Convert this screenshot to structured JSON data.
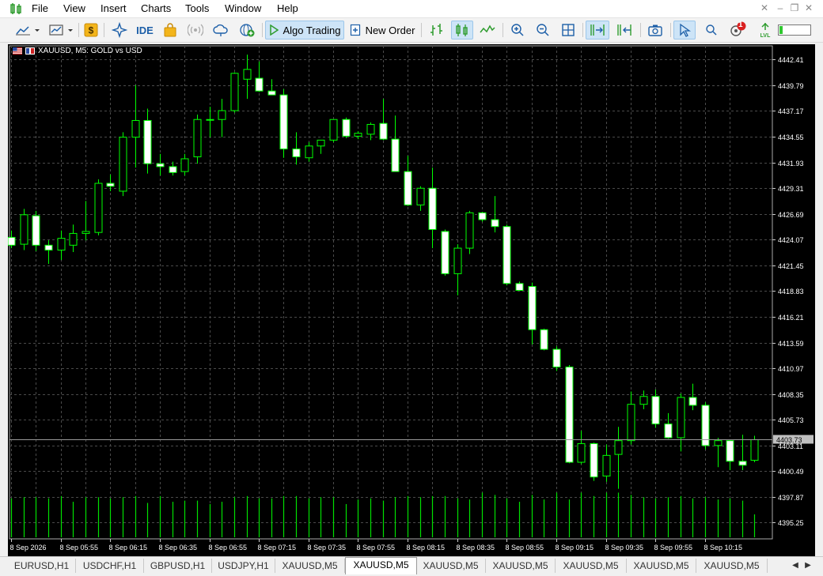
{
  "menu": {
    "items": [
      "File",
      "View",
      "Insert",
      "Charts",
      "Tools",
      "Window",
      "Help"
    ]
  },
  "toolbar": {
    "algo_trading_label": "Algo Trading",
    "new_order_label": "New Order",
    "ide_label": "IDE",
    "notification_count": "1"
  },
  "chart": {
    "title": "XAUUSD, M5:  GOLD vs USD",
    "current_price": "4403.73",
    "colors": {
      "background": "#000000",
      "grid": "#4a4a4a",
      "candle_up": "#000000",
      "candle_down": "#ffffff",
      "candle_border": "#00ff00",
      "volume": "#00e000",
      "price_label": "#c0c0c0",
      "axis_text": "#ffffff"
    }
  },
  "chart_data": {
    "type": "candlestick",
    "symbol": "XAUUSD",
    "timeframe": "M5",
    "y_ticks": [
      "4442.41",
      "4439.79",
      "4437.17",
      "4434.55",
      "4431.93",
      "4429.31",
      "4426.69",
      "4424.07",
      "4421.45",
      "4418.83",
      "4416.21",
      "4413.59",
      "4410.97",
      "4408.35",
      "4405.73",
      "4403.11",
      "4400.49",
      "4397.87",
      "4395.25"
    ],
    "ylim": [
      4393.6,
      4443.8
    ],
    "x_labels": [
      "8 Sep 2026",
      "8 Sep 05:55",
      "8 Sep 06:15",
      "8 Sep 06:35",
      "8 Sep 06:55",
      "8 Sep 07:15",
      "8 Sep 07:35",
      "8 Sep 07:55",
      "8 Sep 08:15",
      "8 Sep 08:35",
      "8 Sep 08:55",
      "8 Sep 09:15",
      "8 Sep 09:35",
      "8 Sep 09:55",
      "8 Sep 10:15"
    ],
    "x_label_every": 4,
    "candles": [
      {
        "o": 4424.3,
        "h": 4425.0,
        "l": 4423.2,
        "c": 4423.5
      },
      {
        "o": 4423.6,
        "h": 4427.2,
        "l": 4423.0,
        "c": 4426.6
      },
      {
        "o": 4426.5,
        "h": 4427.0,
        "l": 4422.9,
        "c": 4423.5
      },
      {
        "o": 4423.5,
        "h": 4424.0,
        "l": 4421.6,
        "c": 4423.0
      },
      {
        "o": 4423.0,
        "h": 4425.0,
        "l": 4422.0,
        "c": 4424.2
      },
      {
        "o": 4423.5,
        "h": 4425.6,
        "l": 4422.8,
        "c": 4424.7
      },
      {
        "o": 4424.7,
        "h": 4428.0,
        "l": 4424.0,
        "c": 4424.9
      },
      {
        "o": 4424.8,
        "h": 4430.2,
        "l": 4424.5,
        "c": 4429.8
      },
      {
        "o": 4429.8,
        "h": 4430.7,
        "l": 4429.0,
        "c": 4429.5
      },
      {
        "o": 4429.0,
        "h": 4435.0,
        "l": 4428.5,
        "c": 4434.5
      },
      {
        "o": 4434.5,
        "h": 4439.8,
        "l": 4431.4,
        "c": 4436.2
      },
      {
        "o": 4436.2,
        "h": 4437.4,
        "l": 4430.8,
        "c": 4431.8
      },
      {
        "o": 4431.8,
        "h": 4432.8,
        "l": 4430.6,
        "c": 4431.5
      },
      {
        "o": 4431.5,
        "h": 4432.0,
        "l": 4430.6,
        "c": 4430.9
      },
      {
        "o": 4431.0,
        "h": 4432.8,
        "l": 4430.6,
        "c": 4432.3
      },
      {
        "o": 4432.5,
        "h": 4436.8,
        "l": 4431.8,
        "c": 4436.3
      },
      {
        "o": 4436.3,
        "h": 4437.6,
        "l": 4434.5,
        "c": 4436.3
      },
      {
        "o": 4436.3,
        "h": 4438.4,
        "l": 4434.5,
        "c": 4437.2
      },
      {
        "o": 4437.2,
        "h": 4441.1,
        "l": 4437.0,
        "c": 4441.0
      },
      {
        "o": 4440.4,
        "h": 4442.9,
        "l": 4438.4,
        "c": 4441.4
      },
      {
        "o": 4440.5,
        "h": 4442.2,
        "l": 4439.1,
        "c": 4439.2
      },
      {
        "o": 4439.2,
        "h": 4440.4,
        "l": 4438.8,
        "c": 4438.8
      },
      {
        "o": 4438.8,
        "h": 4439.4,
        "l": 4432.4,
        "c": 4433.3
      },
      {
        "o": 4433.3,
        "h": 4435.0,
        "l": 4431.7,
        "c": 4432.5
      },
      {
        "o": 4432.4,
        "h": 4434.0,
        "l": 4432.0,
        "c": 4433.6
      },
      {
        "o": 4433.6,
        "h": 4434.0,
        "l": 4432.8,
        "c": 4434.2
      },
      {
        "o": 4434.2,
        "h": 4436.3,
        "l": 4434.0,
        "c": 4436.3
      },
      {
        "o": 4436.3,
        "h": 4436.5,
        "l": 4434.4,
        "c": 4434.6
      },
      {
        "o": 4434.6,
        "h": 4435.1,
        "l": 4434.3,
        "c": 4434.9
      },
      {
        "o": 4434.8,
        "h": 4436.0,
        "l": 4434.2,
        "c": 4435.8
      },
      {
        "o": 4435.9,
        "h": 4438.4,
        "l": 4434.2,
        "c": 4434.3
      },
      {
        "o": 4434.3,
        "h": 4436.7,
        "l": 4431.0,
        "c": 4431.0
      },
      {
        "o": 4431.0,
        "h": 4432.6,
        "l": 4427.5,
        "c": 4427.6
      },
      {
        "o": 4427.6,
        "h": 4429.5,
        "l": 4427.0,
        "c": 4429.3
      },
      {
        "o": 4429.3,
        "h": 4431.4,
        "l": 4423.2,
        "c": 4425.1
      },
      {
        "o": 4424.9,
        "h": 4425.1,
        "l": 4420.4,
        "c": 4420.6
      },
      {
        "o": 4420.6,
        "h": 4423.6,
        "l": 4418.4,
        "c": 4423.2
      },
      {
        "o": 4423.2,
        "h": 4427.0,
        "l": 4422.6,
        "c": 4426.8
      },
      {
        "o": 4426.8,
        "h": 4426.9,
        "l": 4425.9,
        "c": 4426.1
      },
      {
        "o": 4426.1,
        "h": 4428.5,
        "l": 4424.8,
        "c": 4425.4
      },
      {
        "o": 4425.4,
        "h": 4425.6,
        "l": 4419.4,
        "c": 4419.6
      },
      {
        "o": 4419.6,
        "h": 4419.8,
        "l": 4418.9,
        "c": 4418.9
      },
      {
        "o": 4419.3,
        "h": 4419.7,
        "l": 4413.4,
        "c": 4414.9
      },
      {
        "o": 4414.9,
        "h": 4415.0,
        "l": 4412.8,
        "c": 4412.9
      },
      {
        "o": 4412.9,
        "h": 4413.2,
        "l": 4410.7,
        "c": 4411.1
      },
      {
        "o": 4411.1,
        "h": 4411.3,
        "l": 4401.3,
        "c": 4401.4
      },
      {
        "o": 4401.4,
        "h": 4404.6,
        "l": 4401.2,
        "c": 4403.3
      },
      {
        "o": 4403.3,
        "h": 4403.4,
        "l": 4399.5,
        "c": 4399.9
      },
      {
        "o": 4400.0,
        "h": 4403.2,
        "l": 4399.4,
        "c": 4402.1
      },
      {
        "o": 4402.2,
        "h": 4405.0,
        "l": 4398.7,
        "c": 4403.6
      },
      {
        "o": 4403.6,
        "h": 4408.6,
        "l": 4403.2,
        "c": 4407.3
      },
      {
        "o": 4407.3,
        "h": 4408.7,
        "l": 4406.8,
        "c": 4408.1
      },
      {
        "o": 4408.1,
        "h": 4408.8,
        "l": 4404.9,
        "c": 4405.3
      },
      {
        "o": 4405.3,
        "h": 4406.4,
        "l": 4403.8,
        "c": 4403.9
      },
      {
        "o": 4403.9,
        "h": 4408.4,
        "l": 4402.5,
        "c": 4408.0
      },
      {
        "o": 4408.0,
        "h": 4409.4,
        "l": 4406.7,
        "c": 4407.2
      },
      {
        "o": 4407.2,
        "h": 4407.5,
        "l": 4402.7,
        "c": 4403.1
      },
      {
        "o": 4403.1,
        "h": 4403.9,
        "l": 4400.9,
        "c": 4403.6
      },
      {
        "o": 4403.6,
        "h": 4403.7,
        "l": 4400.6,
        "c": 4401.5
      },
      {
        "o": 4401.5,
        "h": 4404.2,
        "l": 4400.6,
        "c": 4401.1
      },
      {
        "o": 4401.6,
        "h": 4404.1,
        "l": 4401.4,
        "c": 4403.7
      }
    ],
    "volumes": [
      68,
      70,
      70,
      68,
      72,
      62,
      70,
      70,
      68,
      70,
      72,
      60,
      72,
      62,
      64,
      64,
      58,
      62,
      70,
      72,
      68,
      68,
      72,
      72,
      68,
      70,
      70,
      58,
      66,
      68,
      64,
      70,
      72,
      70,
      72,
      72,
      68,
      66,
      78,
      74,
      68,
      62,
      74,
      66,
      78,
      66,
      78,
      72,
      78,
      78,
      74,
      70,
      68,
      70,
      72,
      68,
      70,
      66,
      68,
      64,
      40
    ],
    "volume_max": 80
  },
  "tabs": {
    "items": [
      "EURUSD,H1",
      "USDCHF,H1",
      "GBPUSD,H1",
      "USDJPY,H1",
      "XAUUSD,M5",
      "XAUUSD,M5",
      "XAUUSD,M5",
      "XAUUSD,M5",
      "XAUUSD,M5",
      "XAUUSD,M5",
      "XAUUSD,M5"
    ],
    "active_index": 5
  }
}
